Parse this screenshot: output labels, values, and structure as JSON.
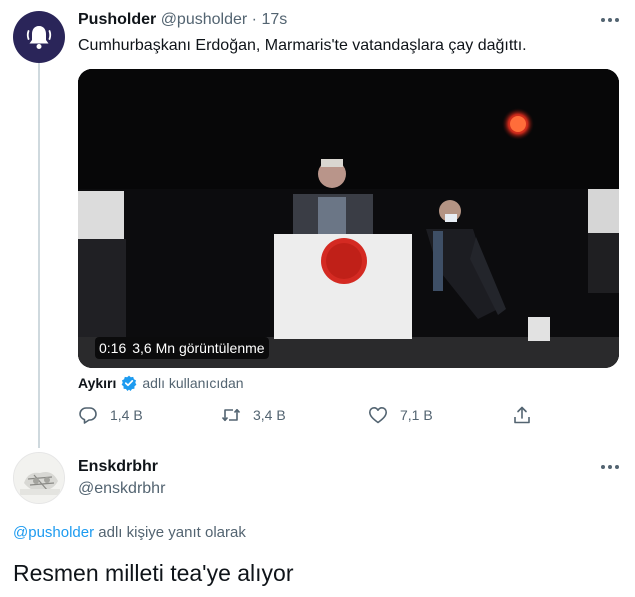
{
  "tweet": {
    "author_name": "Pusholder",
    "author_handle": "@pusholder",
    "separator": "·",
    "time": "17s",
    "text": "Cumhurbaşkanı Erdoğan, Marmaris'te vatandaşlara çay dağıttı.",
    "avatar_icon": "bell-icon",
    "media": {
      "duration": "0:16",
      "views": "3,6 Mn görüntülenme"
    },
    "attribution": {
      "source": "Aykırı",
      "suffix": "adlı kullanıcıdan"
    },
    "actions": {
      "replies": "1,4 B",
      "retweets": "3,4 B",
      "likes": "7,1 B"
    }
  },
  "reply": {
    "author_name": "Enskdrbhr",
    "author_handle": "@enskdrbhr",
    "replying_to_mention": "@pusholder",
    "replying_to_suffix": "adlı kişiye yanıt olarak",
    "text": "Resmen milleti tea'ye alıyor"
  },
  "colors": {
    "accent": "#1d9bf0",
    "secondary_text": "#536471",
    "primary_text": "#0f1419",
    "avatar_bg": "#2a2559"
  }
}
